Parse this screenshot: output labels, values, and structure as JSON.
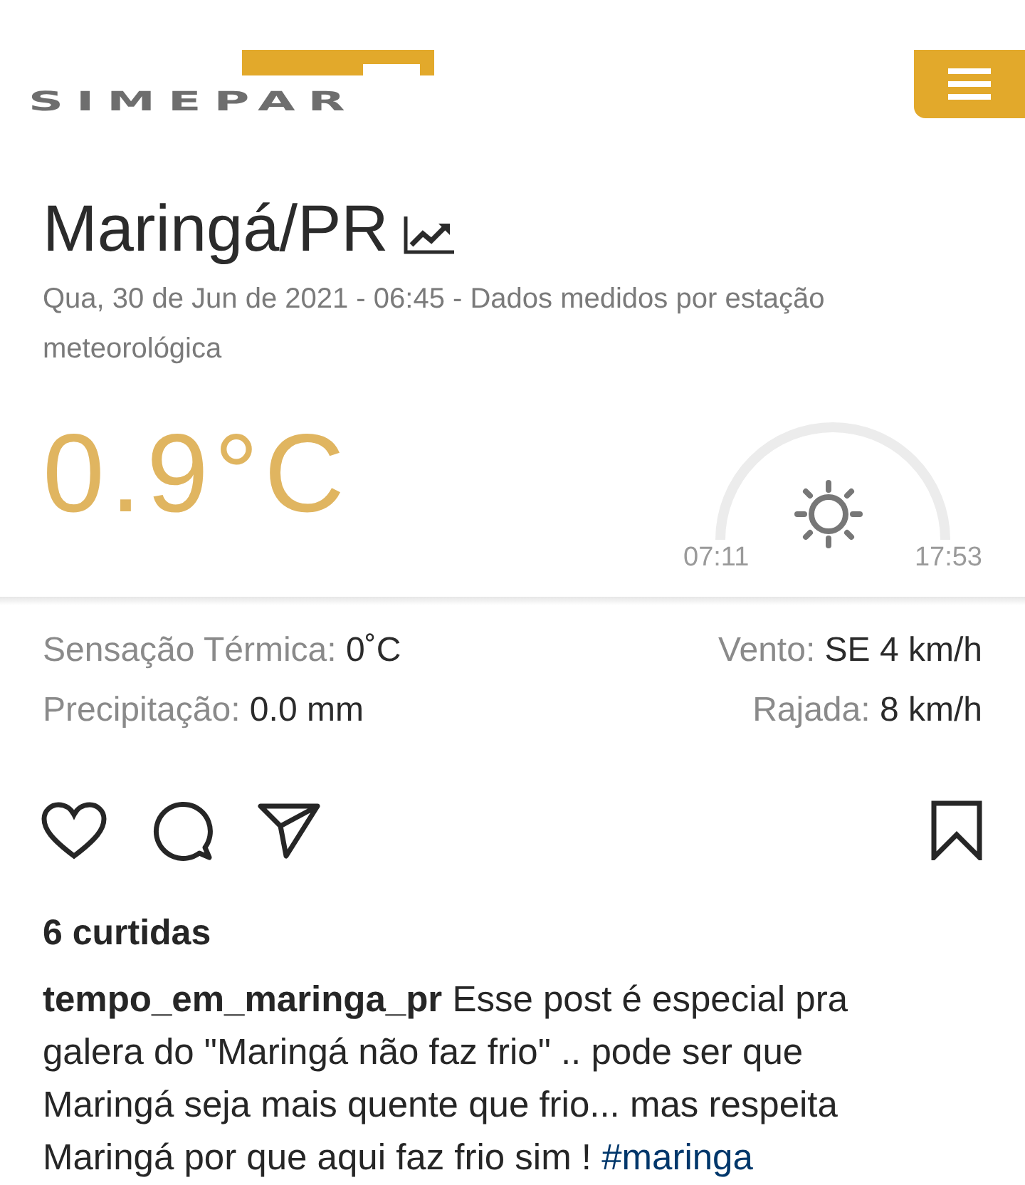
{
  "header": {
    "logo": "SIMEPAR"
  },
  "station": {
    "title": "Maringá/PR",
    "subtitle": "Qua, 30 de Jun de 2021 - 06:45 - Dados medidos por estação meteorológica"
  },
  "current": {
    "temperature": "0.9°C",
    "sunrise": "07:11",
    "sunset": "17:53"
  },
  "details": [
    {
      "left": {
        "label": "Sensação Térmica:",
        "value": "0˚C"
      },
      "right": {
        "label": "Vento:",
        "value": "SE 4 km/h"
      }
    },
    {
      "left": {
        "label": "Precipitação:",
        "value": "0.0 mm"
      },
      "right": {
        "label": "Rajada:",
        "value": "8 km/h"
      }
    }
  ],
  "post": {
    "likes": "6 curtidas",
    "username": "tempo_em_maringa_pr",
    "caption": "Esse post é especial pra galera do \"Maringá não faz frio\" .. pode ser que Maringá seja mais quente que frio... mas respeita Maringá por que aqui faz frio sim !",
    "hashtag": "#maringa"
  }
}
